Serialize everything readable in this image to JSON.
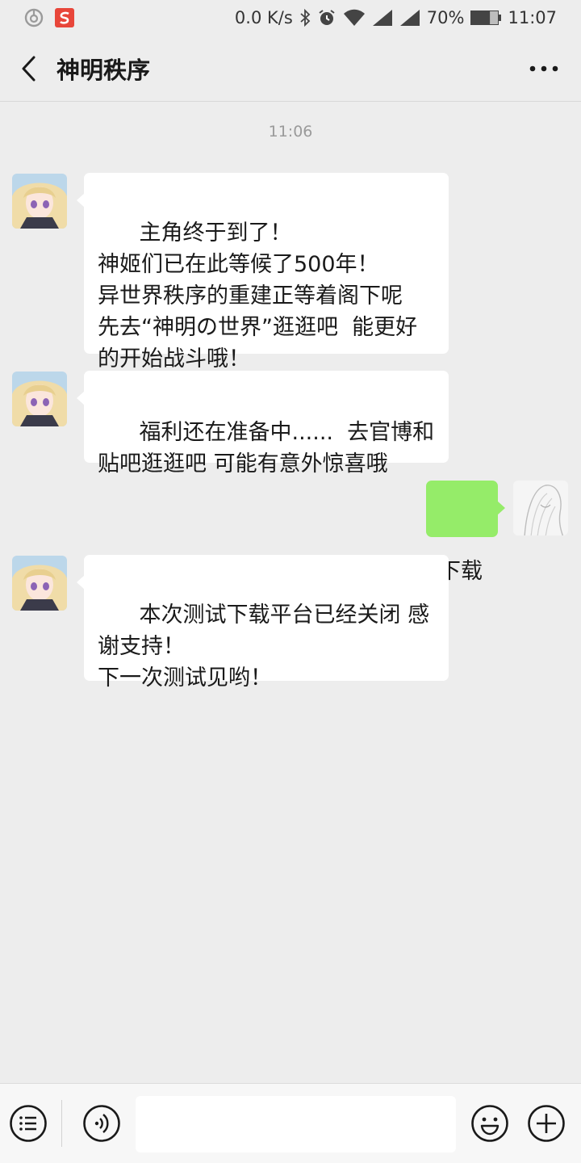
{
  "status_bar": {
    "left_icons": [
      "netease-music-icon",
      "sogou-icon"
    ],
    "network_speed": "0.0 K/s",
    "battery_percent": "70%",
    "battery_level": 0.7,
    "time": "11:07"
  },
  "header": {
    "title": "神明秩序"
  },
  "chat": {
    "timestamp": "11:06",
    "messages": [
      {
        "direction": "incoming",
        "text": "主角终于到了！\n神姬们已在此等候了500年！\n异世界秩序的重建正等着阁下呢\n先去“神明の世界”逛逛吧  能更好的开始战斗哦！"
      },
      {
        "direction": "incoming",
        "text": "福利还在准备中......  去官博和贴吧逛逛吧 可能有意外惊喜哦"
      },
      {
        "direction": "outgoing",
        "text": "下载"
      },
      {
        "direction": "incoming",
        "text": "本次测试下载平台已经关闭 感谢支持！\n下一次测试见哟！"
      }
    ]
  },
  "input_bar": {
    "input_value": "",
    "icons": [
      "menu-icon",
      "voice-icon",
      "emoji-icon",
      "plus-icon"
    ]
  },
  "colors": {
    "background": "#ededed",
    "incoming_bubble": "#ffffff",
    "outgoing_bubble": "#95ec69",
    "timestamp": "#9a9a9a"
  }
}
